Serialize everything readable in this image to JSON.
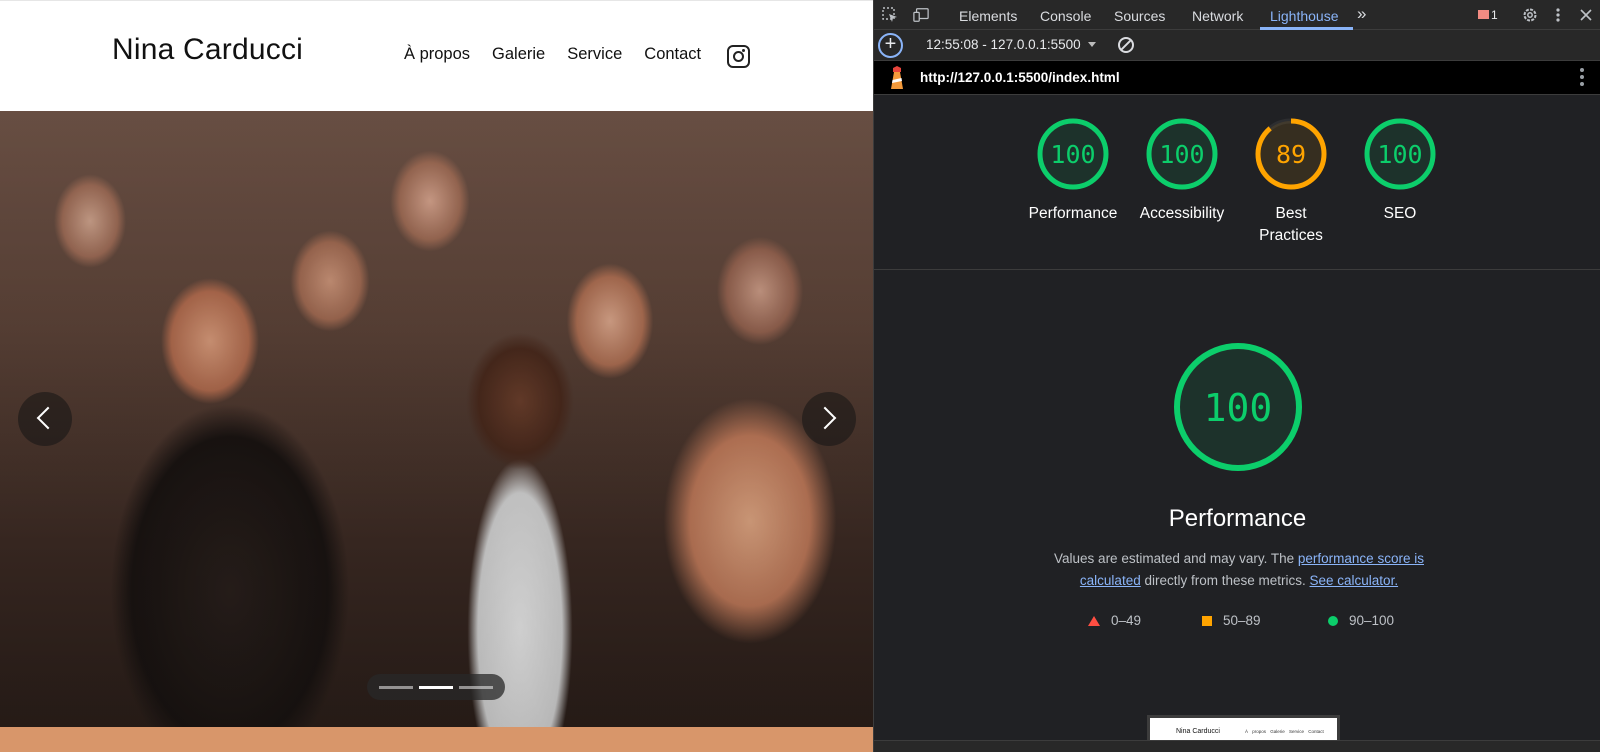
{
  "site": {
    "brand": "Nina Carducci",
    "nav": [
      "À propos",
      "Galerie",
      "Service",
      "Contact"
    ],
    "hero_alt": "concert crowd photo",
    "carousel": {
      "slides": 3,
      "active_index": 1
    },
    "colors": {
      "accent_band": "#d8966a"
    }
  },
  "devtools": {
    "tabs": [
      "Elements",
      "Console",
      "Sources",
      "Network",
      "Lighthouse"
    ],
    "active_tab": "Lighthouse",
    "more_tabs": "»",
    "issues_count": "1",
    "report_select": "12:55:08 - 127.0.0.1:5500",
    "url": "http://127.0.0.1:5500/index.html",
    "scores": [
      {
        "name": "Performance",
        "score": 100,
        "color": "#0cce6b"
      },
      {
        "name": "Accessibility",
        "score": 100,
        "color": "#0cce6b"
      },
      {
        "name": "Best Practices",
        "score": 89,
        "color": "#ffa400"
      },
      {
        "name": "SEO",
        "score": 100,
        "color": "#0cce6b"
      }
    ],
    "main": {
      "score": "100",
      "title": "Performance",
      "note_prefix": "Values are estimated and may vary. The ",
      "note_link1": "performance score is calculated",
      "note_middle": " directly from these metrics. ",
      "note_link2": "See calculator."
    },
    "legend": [
      {
        "range": "0–49",
        "shape": "triangle",
        "color": "#ff4e42"
      },
      {
        "range": "50–89",
        "shape": "square",
        "color": "#ffa400"
      },
      {
        "range": "90–100",
        "shape": "circle",
        "color": "#0cce6b"
      }
    ],
    "thumbnail": {
      "brand": "Nina Carducci",
      "nav": "À propos Galerie Service Contact"
    }
  }
}
